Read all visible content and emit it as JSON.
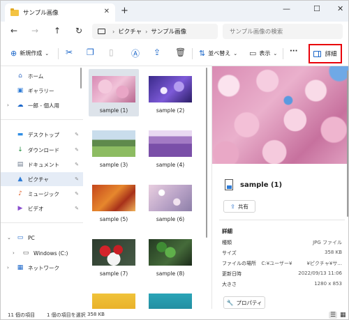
{
  "window": {
    "tab_title": "サンプル画像",
    "tab_close": "✕",
    "new_tab": "+",
    "minimize": "—",
    "maximize": "☐",
    "close": "✕"
  },
  "nav": {
    "back": "←",
    "forward": "→",
    "up": "↑",
    "refresh": "↻",
    "breadcrumb": [
      "ピクチャ",
      "サンプル画像"
    ],
    "breadcrumb_sep": "›",
    "search_placeholder": "サンプル画像の検索"
  },
  "toolbar": {
    "new_label": "新規作成",
    "new_chevron": "⌄",
    "sort_label": "並べ替え",
    "sort_chevron": "⌄",
    "view_label": "表示",
    "view_chevron": "⌄",
    "more": "···",
    "details_label": "詳細"
  },
  "sidebar": {
    "items": [
      {
        "label": "ホーム",
        "icon": "home-icon",
        "glyph": "⌂",
        "color": "#3a6fc4"
      },
      {
        "label": "ギャラリー",
        "icon": "gallery-icon",
        "glyph": "▣",
        "color": "#2d7bd6"
      },
      {
        "label": "一郎 - 個人用",
        "icon": "cloud-icon",
        "glyph": "☁",
        "color": "#1a66c9"
      },
      {
        "label": "デスクトップ",
        "icon": "desktop-icon",
        "glyph": "▬",
        "color": "#2f8de4"
      },
      {
        "label": "ダウンロード",
        "icon": "download-icon",
        "glyph": "↓",
        "color": "#1a8a3a"
      },
      {
        "label": "ドキュメント",
        "icon": "document-icon",
        "glyph": "▤",
        "color": "#6d7b8d"
      },
      {
        "label": "ピクチャ",
        "icon": "pictures-icon",
        "glyph": "▲",
        "color": "#2d7bd6"
      },
      {
        "label": "ミュージック",
        "icon": "music-icon",
        "glyph": "♪",
        "color": "#e0561b"
      },
      {
        "label": "ビデオ",
        "icon": "video-icon",
        "glyph": "▶",
        "color": "#8a4fcf"
      },
      {
        "label": "PC",
        "icon": "pc-icon",
        "glyph": "▭",
        "color": "#1a66c9"
      },
      {
        "label": "Windows (C:)",
        "icon": "drive-icon",
        "glyph": "▭",
        "color": "#555555"
      },
      {
        "label": "ネットワーク",
        "icon": "network-icon",
        "glyph": "▦",
        "color": "#1a66c9"
      }
    ],
    "pin": "📌"
  },
  "files": [
    {
      "name": "sample (1)",
      "selected": true
    },
    {
      "name": "sample (2)"
    },
    {
      "name": "sample (3)"
    },
    {
      "name": "sample (4)"
    },
    {
      "name": "sample (5)"
    },
    {
      "name": "sample (6)"
    },
    {
      "name": "sample (7)"
    },
    {
      "name": "sample (8)"
    },
    {
      "name": ""
    },
    {
      "name": ""
    }
  ],
  "preview": {
    "title": "sample (1)",
    "share_label": "共有",
    "section_label": "詳細",
    "properties": [
      {
        "key": "種類",
        "value": "JPG ファイル"
      },
      {
        "key": "サイズ",
        "value": "358 KB"
      },
      {
        "key": "ファイルの場所",
        "value": "C:¥ユーザー¥　　　¥ピクチャ¥サ..."
      },
      {
        "key": "更新日時",
        "value": "2022/09/13 11:06"
      },
      {
        "key": "大きさ",
        "value": "1280 x 853"
      }
    ],
    "properties_label": "プロパティ"
  },
  "status": {
    "item_count": "11 個の項目",
    "selection": "1 個の項目を選択",
    "selection_size": "358 KB"
  }
}
